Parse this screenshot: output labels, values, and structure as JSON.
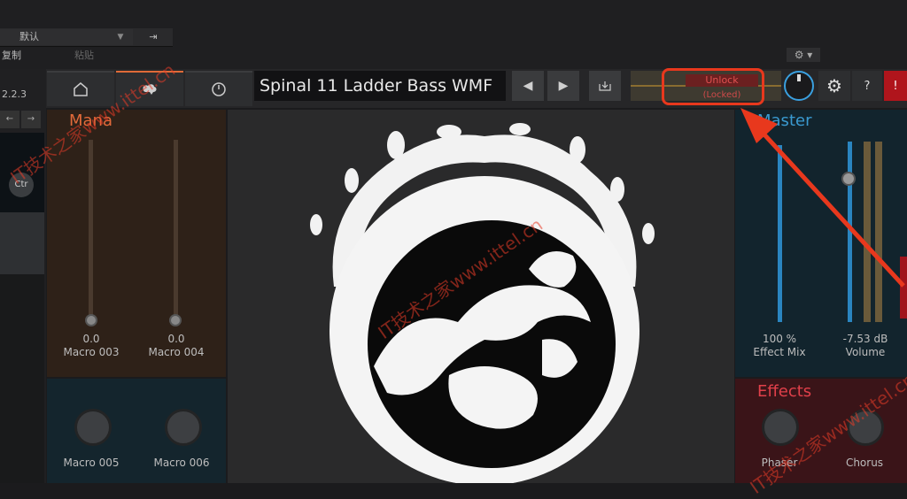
{
  "host": {
    "preset_select": "默认",
    "copy_label": "复制",
    "paste_label": "粘贴",
    "version": "2.2.3",
    "left_tab_a": "←",
    "left_tab_b": "→",
    "ctr_label": "Ctr"
  },
  "header": {
    "preset_name": "Spinal 11 Ladder Bass WMF",
    "unlock_label": "Unlock",
    "locked_label": "(Locked)",
    "help_label": "?",
    "alert_label": "!"
  },
  "mana": {
    "title": "Mana",
    "macros": [
      {
        "name": "Macro 003",
        "value": "0.0"
      },
      {
        "name": "Macro 004",
        "value": "0.0"
      }
    ]
  },
  "macros_lower": [
    {
      "name": "Macro 005"
    },
    {
      "name": "Macro 006"
    }
  ],
  "master": {
    "title": "Master",
    "effect_mix": {
      "name": "Effect Mix",
      "value": "100 %"
    },
    "volume": {
      "name": "Volume",
      "value": "-7.53 dB"
    }
  },
  "effects": {
    "title": "Effects",
    "knobs": [
      {
        "name": "Phaser"
      },
      {
        "name": "Chorus"
      }
    ]
  },
  "watermarks": [
    "IT技术之家www.ittel.cn",
    "IT技术之家www.ittel.cn",
    "IT技术之家www.ittel.cn"
  ],
  "colors": {
    "accent_orange": "#e06a38",
    "accent_blue": "#3a9ad0",
    "alert_red": "#b0151c",
    "highlight_red": "#e8381d"
  }
}
